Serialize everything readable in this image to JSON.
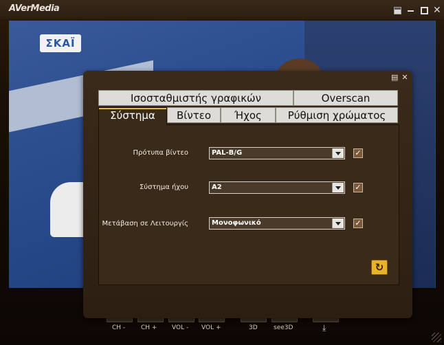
{
  "app": {
    "brand": "AVerMedia",
    "window_buttons": [
      "tile-icon",
      "minimize-icon",
      "maximize-icon",
      "close-icon"
    ]
  },
  "video": {
    "channel_logo": "ΣΚΑΪ"
  },
  "controls": {
    "ch_minus": "CH -",
    "ch_plus": "CH +",
    "vol_minus": "VOL -",
    "vol_plus": "VOL +",
    "btn_3d": "3D",
    "see3d": "see3D",
    "download_icon": "download-icon"
  },
  "dialog": {
    "tabs_back": [
      "Ισοσταθμιστής γραφικών",
      "Overscan"
    ],
    "tabs_front": [
      "Σύστημα",
      "Βίντεο",
      "Ήχος",
      "Ρύθμιση χρώματος"
    ],
    "active_tab": "Σύστημα",
    "rows": [
      {
        "label": "Πρότυπα βίντεο",
        "value": "PAL-B/G",
        "checked": true
      },
      {
        "label": "Σύστημα ήχου",
        "value": "A2",
        "checked": true
      },
      {
        "label": "Μετάβαση σε Λειτουργίς",
        "value": "Μονοφωνικό",
        "checked": true
      }
    ],
    "reset_icon": "refresh-icon"
  },
  "colors": {
    "accent": "#e2c430",
    "panel": "#3a2a1a",
    "tab_bg": "#dedcd6"
  }
}
